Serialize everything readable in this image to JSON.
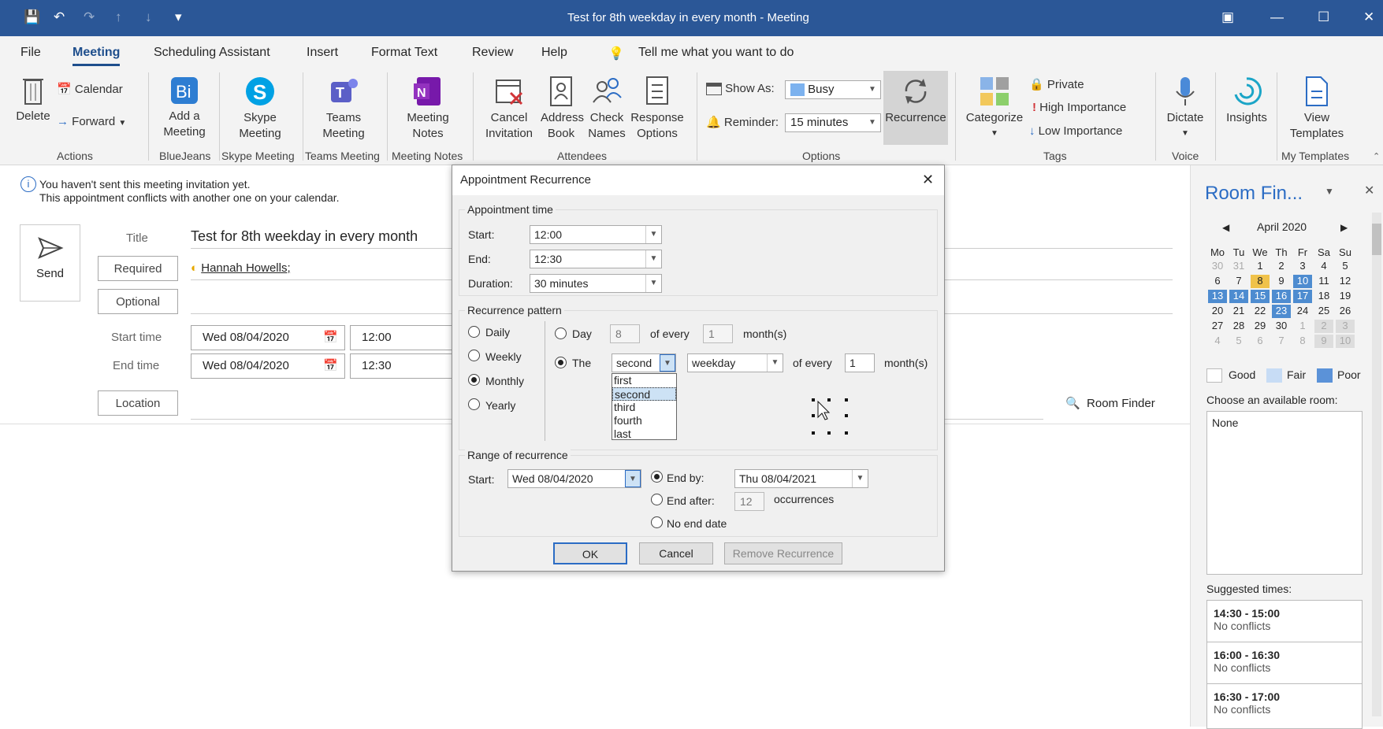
{
  "window": {
    "title": "Test for 8th weekday in every month  -  Meeting"
  },
  "menu": [
    "File",
    "Meeting",
    "Scheduling Assistant",
    "Insert",
    "Format Text",
    "Review",
    "Help"
  ],
  "tellme": "Tell me what you want to do",
  "ribbon": {
    "delete": "Delete",
    "calendar": "Calendar",
    "forward": "Forward",
    "actions": "Actions",
    "addmeeting": "Add a Meeting",
    "bluejeans": "BlueJeans",
    "skype": "Skype Meeting",
    "skype_group": "Skype Meeting",
    "teams": "Teams Meeting",
    "teams_group": "Teams Meeting",
    "notes": "Meeting Notes",
    "notes_group": "Meeting Notes",
    "cancel": "Cancel Invitation",
    "address": "Address Book",
    "check": "Check Names",
    "response": "Response Options",
    "attendees": "Attendees",
    "showas_label": "Show As:",
    "showas_value": "Busy",
    "reminder_label": "Reminder:",
    "reminder_value": "15 minutes",
    "recurrence": "Recurrence",
    "options": "Options",
    "categorize": "Categorize",
    "private": "Private",
    "high": "High Importance",
    "low": "Low Importance",
    "tags": "Tags",
    "dictate": "Dictate",
    "voice": "Voice",
    "insights": "Insights",
    "templates": "View Templates",
    "mytemplates": "My Templates"
  },
  "info": {
    "line1": "You haven't sent this meeting invitation yet.",
    "line2": "This appointment conflicts with another one on your calendar."
  },
  "form": {
    "send": "Send",
    "title_label": "Title",
    "title_value": "Test for 8th weekday in every month",
    "required": "Required",
    "attendee": "Hannah Howells;",
    "optional": "Optional",
    "start_label": "Start time",
    "start_date": "Wed 08/04/2020",
    "start_time": "12:00",
    "end_label": "End time",
    "end_date": "Wed 08/04/2020",
    "end_time": "12:30",
    "location": "Location",
    "roomfinder": "Room Finder"
  },
  "dialog": {
    "title": "Appointment Recurrence",
    "appt_time": "Appointment time",
    "start_label": "Start:",
    "start": "12:00",
    "end_label": "End:",
    "end": "12:30",
    "duration_label": "Duration:",
    "duration": "30 minutes",
    "pattern": "Recurrence pattern",
    "daily": "Daily",
    "weekly": "Weekly",
    "monthly": "Monthly",
    "yearly": "Yearly",
    "day_label": "Day",
    "day_num": "8",
    "of_every": "of every",
    "every_num": "1",
    "months": "month(s)",
    "the_label": "The",
    "ordinal": "second",
    "weekday": "weekday",
    "of_every2": "of every",
    "every_num2": "1",
    "months2": "month(s)",
    "options": [
      "first",
      "second",
      "third",
      "fourth",
      "last"
    ],
    "range": "Range of recurrence",
    "range_start_label": "Start:",
    "range_start": "Wed 08/04/2020",
    "endby": "End by:",
    "endby_date": "Thu 08/04/2021",
    "endafter": "End after:",
    "occ_num": "12",
    "occurrences": "occurrences",
    "noend": "No end date",
    "ok": "OK",
    "cancel": "Cancel",
    "remove": "Remove Recurrence"
  },
  "room": {
    "title": "Room Fin...",
    "month": "April 2020",
    "days": [
      "Mo",
      "Tu",
      "We",
      "Th",
      "Fr",
      "Sa",
      "Su"
    ],
    "weeks": [
      [
        "30",
        "31",
        "1",
        "2",
        "3",
        "4",
        "5"
      ],
      [
        "6",
        "7",
        "8",
        "9",
        "10",
        "11",
        "12"
      ],
      [
        "13",
        "14",
        "15",
        "16",
        "17",
        "18",
        "19"
      ],
      [
        "20",
        "21",
        "22",
        "23",
        "24",
        "25",
        "26"
      ],
      [
        "27",
        "28",
        "29",
        "30",
        "1",
        "2",
        "3"
      ],
      [
        "4",
        "5",
        "6",
        "7",
        "8",
        "9",
        "10"
      ]
    ],
    "good": "Good",
    "fair": "Fair",
    "poor": "Poor",
    "choose": "Choose an available room:",
    "none": "None",
    "suggested": "Suggested times:",
    "sug": [
      {
        "time": "14:30 - 15:00",
        "status": "No conflicts"
      },
      {
        "time": "16:00 - 16:30",
        "status": "No conflicts"
      },
      {
        "time": "16:30 - 17:00",
        "status": "No conflicts"
      }
    ]
  }
}
